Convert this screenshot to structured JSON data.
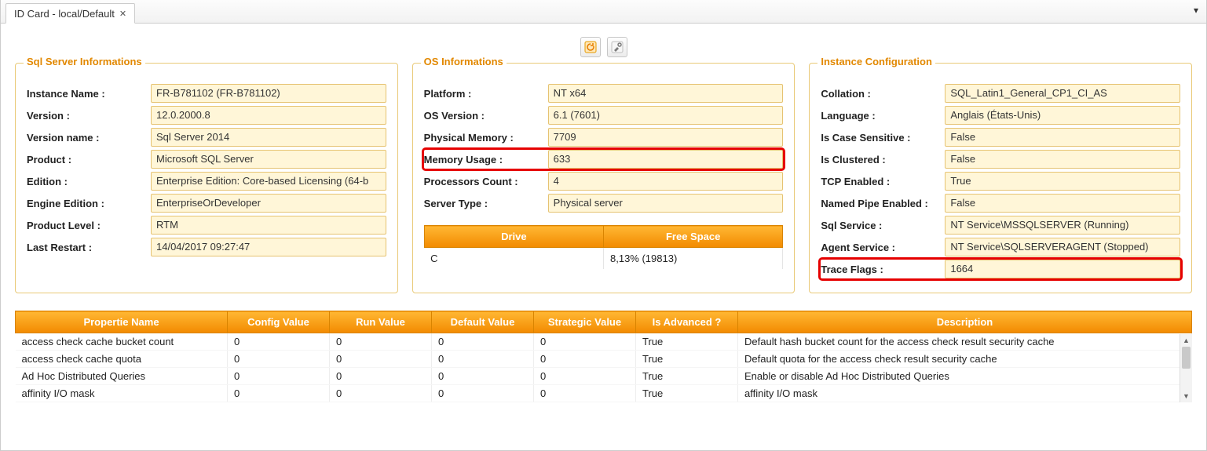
{
  "tab": {
    "title": "ID Card - local/Default"
  },
  "groups": {
    "sql": {
      "title": "Sql Server Informations",
      "rows": {
        "instance_name": {
          "label": "Instance Name :",
          "value": "FR-B781102 (FR-B781102)"
        },
        "version": {
          "label": "Version :",
          "value": "12.0.2000.8"
        },
        "version_name": {
          "label": "Version name :",
          "value": "Sql Server 2014"
        },
        "product": {
          "label": "Product :",
          "value": "Microsoft SQL Server"
        },
        "edition": {
          "label": "Edition :",
          "value": "Enterprise Edition: Core-based Licensing (64-b"
        },
        "engine_edition": {
          "label": "Engine Edition :",
          "value": "EnterpriseOrDeveloper"
        },
        "product_level": {
          "label": "Product Level :",
          "value": "RTM"
        },
        "last_restart": {
          "label": "Last Restart :",
          "value": "14/04/2017 09:27:47"
        }
      }
    },
    "os": {
      "title": "OS Informations",
      "rows": {
        "platform": {
          "label": "Platform :",
          "value": "NT x64"
        },
        "os_version": {
          "label": "OS Version :",
          "value": "6.1 (7601)"
        },
        "physical_memory": {
          "label": "Physical Memory :",
          "value": "7709"
        },
        "memory_usage": {
          "label": "Memory Usage :",
          "value": "633"
        },
        "processors_count": {
          "label": "Processors Count :",
          "value": "4"
        },
        "server_type": {
          "label": "Server Type :",
          "value": "Physical server"
        }
      },
      "drive_headers": {
        "drive": "Drive",
        "free": "Free Space"
      },
      "drives": [
        {
          "letter": "C",
          "free": "8,13% (19813)"
        }
      ]
    },
    "instance": {
      "title": "Instance Configuration",
      "rows": {
        "collation": {
          "label": "Collation :",
          "value": "SQL_Latin1_General_CP1_CI_AS"
        },
        "language": {
          "label": "Language :",
          "value": "Anglais (États-Unis)"
        },
        "is_case_sensitive": {
          "label": "Is Case Sensitive :",
          "value": "False"
        },
        "is_clustered": {
          "label": "Is Clustered :",
          "value": "False"
        },
        "tcp_enabled": {
          "label": "TCP Enabled :",
          "value": "True"
        },
        "named_pipe_enabled": {
          "label": "Named Pipe Enabled :",
          "value": "False"
        },
        "sql_service": {
          "label": "Sql Service :",
          "value": "NT Service\\MSSQLSERVER (Running)"
        },
        "agent_service": {
          "label": "Agent Service :",
          "value": "NT Service\\SQLSERVERAGENT (Stopped)"
        },
        "trace_flags": {
          "label": "Trace Flags :",
          "value": "1664"
        }
      }
    }
  },
  "props_table": {
    "headers": {
      "name": "Propertie Name",
      "config": "Config Value",
      "run": "Run Value",
      "default": "Default Value",
      "strategic": "Strategic Value",
      "advanced": "Is Advanced ?",
      "description": "Description"
    },
    "rows": [
      {
        "name": "access check cache bucket count",
        "config": "0",
        "run": "0",
        "default": "0",
        "strategic": "0",
        "advanced": "True",
        "description": "Default hash bucket count for the access check result security cache"
      },
      {
        "name": "access check cache quota",
        "config": "0",
        "run": "0",
        "default": "0",
        "strategic": "0",
        "advanced": "True",
        "description": "Default quota for the access check result security cache"
      },
      {
        "name": "Ad Hoc Distributed Queries",
        "config": "0",
        "run": "0",
        "default": "0",
        "strategic": "0",
        "advanced": "True",
        "description": "Enable or disable Ad Hoc Distributed Queries"
      },
      {
        "name": "affinity I/O mask",
        "config": "0",
        "run": "0",
        "default": "0",
        "strategic": "0",
        "advanced": "True",
        "description": "affinity I/O mask"
      }
    ]
  }
}
